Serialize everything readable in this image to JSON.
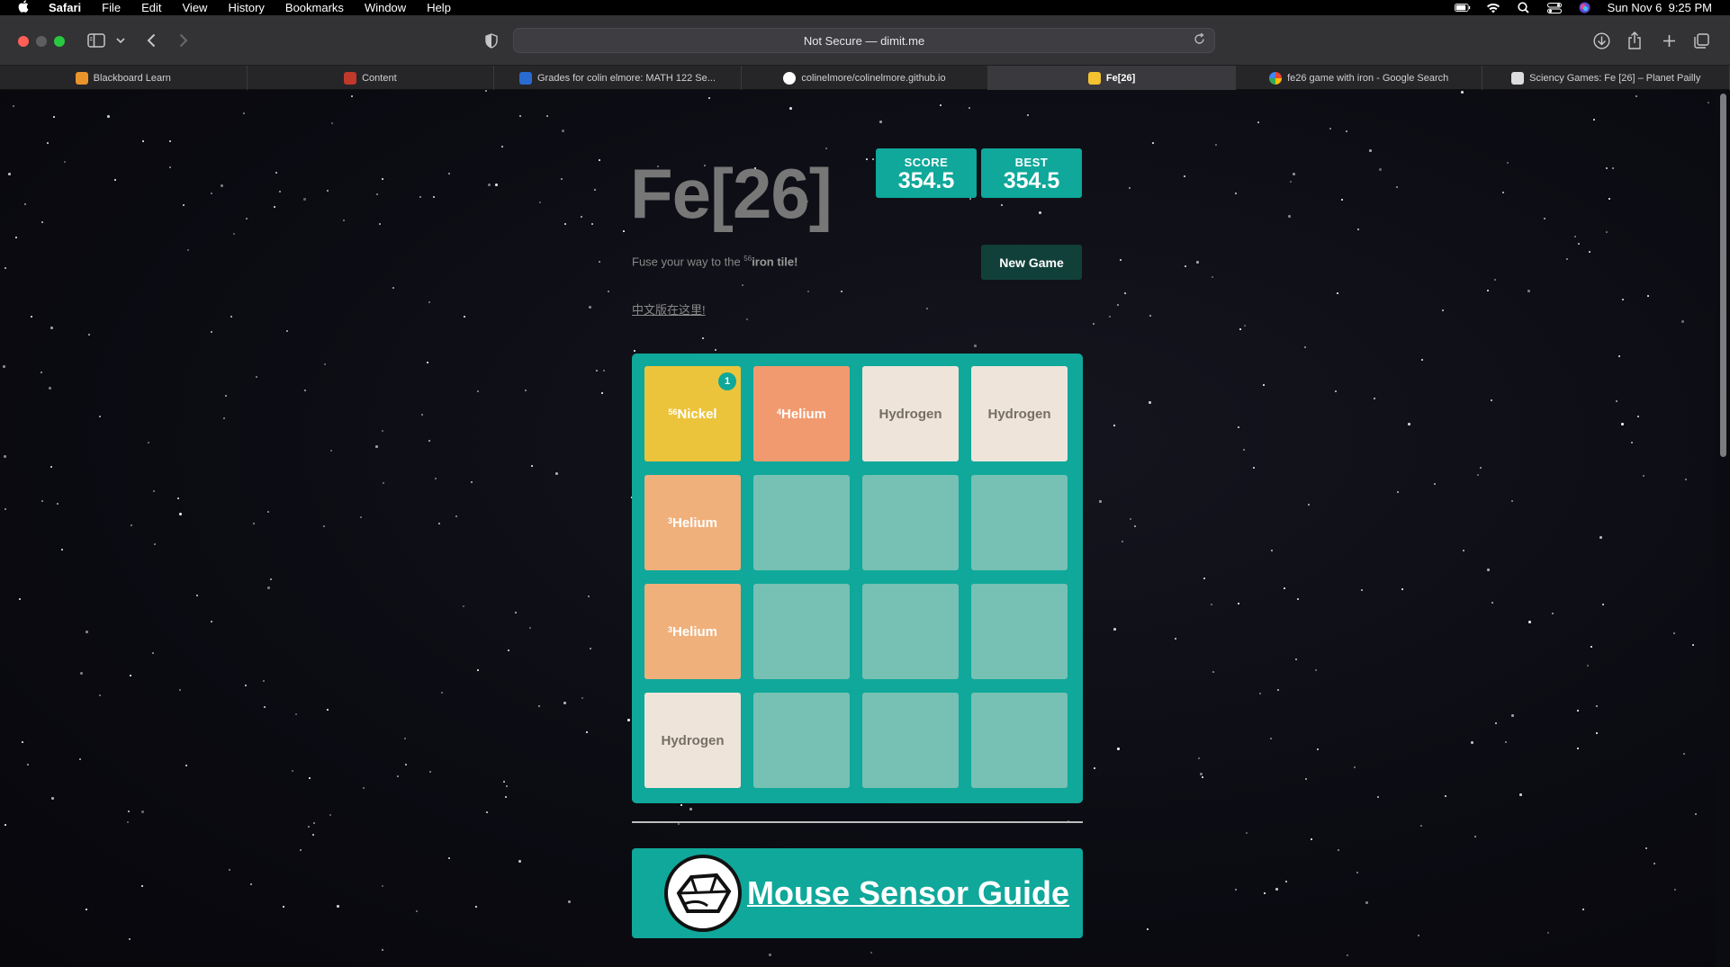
{
  "menubar": {
    "app": "Safari",
    "items": [
      "File",
      "Edit",
      "View",
      "History",
      "Bookmarks",
      "Window",
      "Help"
    ],
    "datetime": "Sun Nov 6  9:25 PM"
  },
  "toolbar": {
    "url_text": "Not Secure — dimit.me"
  },
  "tabs": [
    {
      "label": "Blackboard Learn",
      "favicon_color": "#e8942a"
    },
    {
      "label": "Content",
      "favicon_color": "#c0392b"
    },
    {
      "label": "Grades for colin elmore: MATH 122 Se...",
      "favicon_color": "#2a6bd1"
    },
    {
      "label": "colinelmore/colinelmore.github.io",
      "favicon_color": "#ffffff"
    },
    {
      "label": "Fe[26]",
      "favicon_color": "#f2c230",
      "active": true
    },
    {
      "label": "fe26 game with iron - Google Search",
      "favicon_color": "#ffffff"
    },
    {
      "label": "Sciency Games: Fe [26] – Planet Pailly",
      "favicon_color": "#dddddd"
    }
  ],
  "game": {
    "title": "Fe[26]",
    "score_label": "SCORE",
    "score_value": "354.5",
    "best_label": "BEST",
    "best_value": "354.5",
    "subtitle_pre": "Fuse your way to the ",
    "subtitle_sup": "56",
    "subtitle_bold": "iron tile!",
    "new_game_label": "New Game",
    "chinese_link": "中文版在这里!",
    "tiles": [
      {
        "row": 0,
        "col": 0,
        "sup": "56",
        "name": "Nickel",
        "bg": "#ecc43b",
        "fg": "#ffffff",
        "badge": "1"
      },
      {
        "row": 0,
        "col": 1,
        "sup": "4",
        "name": "Helium",
        "bg": "#f29a6f",
        "fg": "#ffffff"
      },
      {
        "row": 0,
        "col": 2,
        "sup": "",
        "name": "Hydrogen",
        "bg": "#eee4da",
        "fg": "#776e65"
      },
      {
        "row": 0,
        "col": 3,
        "sup": "",
        "name": "Hydrogen",
        "bg": "#eee4da",
        "fg": "#776e65"
      },
      {
        "row": 1,
        "col": 0,
        "sup": "3",
        "name": "Helium",
        "bg": "#f0b07b",
        "fg": "#ffffff"
      },
      {
        "row": 2,
        "col": 0,
        "sup": "3",
        "name": "Helium",
        "bg": "#f0b07b",
        "fg": "#ffffff"
      },
      {
        "row": 3,
        "col": 0,
        "sup": "",
        "name": "Hydrogen",
        "bg": "#eee4da",
        "fg": "#776e65"
      }
    ]
  },
  "banner": {
    "text": "Mouse Sensor Guide"
  },
  "colors": {
    "teal": "#0fa89a",
    "empty_cell": "#77c0b4",
    "new_game_bg": "#11403a"
  }
}
